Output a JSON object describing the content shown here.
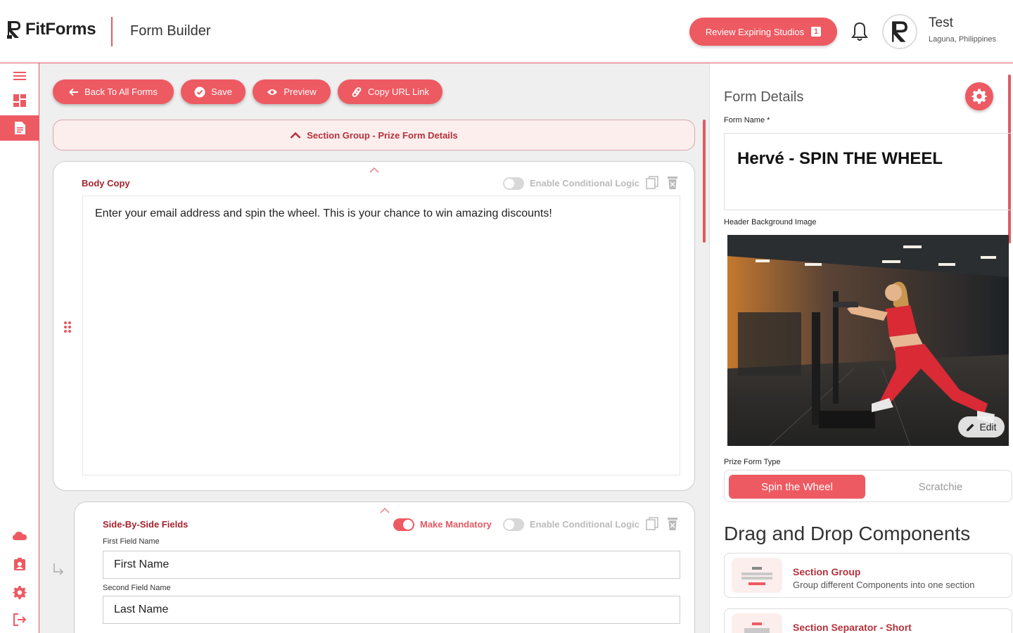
{
  "app": {
    "logo_text": "FitForms",
    "page_heading": "Form Builder",
    "review_button_label": "Review Expiring Studios",
    "review_badge_count": "1",
    "user_name": "Test",
    "user_location": "Laguna, Philippines"
  },
  "leftnav": {
    "items": [
      {
        "icon": "menu-icon",
        "active": false
      },
      {
        "icon": "dashboard-icon",
        "active": false
      },
      {
        "icon": "document-icon",
        "active": true
      },
      {
        "icon": "cloud-icon",
        "active": false
      },
      {
        "icon": "badge-icon",
        "active": false
      },
      {
        "icon": "gear-icon",
        "active": false
      },
      {
        "icon": "logout-icon",
        "active": false
      }
    ]
  },
  "toolbar": {
    "back_label": "Back To All Forms",
    "save_label": "Save",
    "preview_label": "Preview",
    "copy_url_label": "Copy URL Link"
  },
  "section_group": {
    "label": "Section Group - Prize Form Details"
  },
  "body_copy_card": {
    "title": "Body Copy",
    "conditional_logic_label": "Enable Conditional Logic",
    "text": "Enter your email address and spin the wheel. This is your chance to win amazing discounts!"
  },
  "side_by_side_card": {
    "title": "Side-By-Side Fields",
    "mandatory_label": "Make Mandatory",
    "conditional_logic_label": "Enable Conditional Logic",
    "first_field_label": "First Field Name",
    "first_field_value": "First Name",
    "second_field_label": "Second Field Name",
    "second_field_value": "Last Name"
  },
  "form_details": {
    "title": "Form Details",
    "form_name_label": "Form Name *",
    "form_name_value": "Hervé - SPIN THE WHEEL",
    "header_bg_label": "Header Background Image",
    "edit_label": "Edit",
    "prize_type_label": "Prize Form Type",
    "prize_types": [
      "Spin the Wheel",
      "Scratchie"
    ],
    "selected_prize_type": "Spin the Wheel"
  },
  "components": {
    "title": "Drag and Drop Components",
    "items": [
      {
        "name": "Section Group",
        "description": "Group different Components into one section"
      },
      {
        "name": "Section Separator - Short",
        "description": ""
      }
    ]
  },
  "colors": {
    "accent": "#ee5a62",
    "accent_dark": "#a3232d",
    "panel_bg": "#efefef"
  }
}
